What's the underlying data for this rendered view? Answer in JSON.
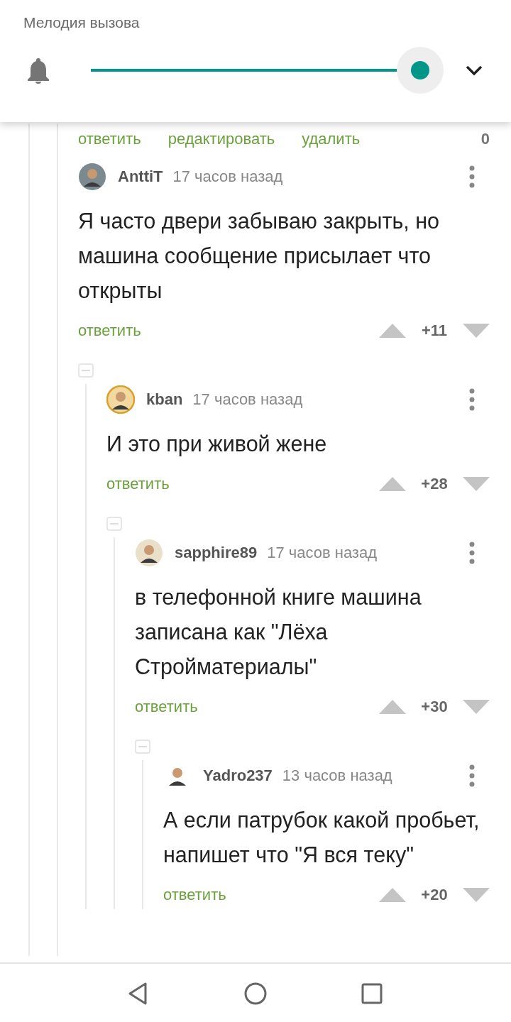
{
  "volume_panel": {
    "title": "Мелодия вызова",
    "slider": {
      "level": 1
    }
  },
  "previous_comment_actions": {
    "links": [
      "ответить",
      "редактировать",
      "удалить"
    ],
    "score": "0"
  },
  "comments": [
    {
      "author": "AnttiT",
      "time": "17 часов назад",
      "text": "Я часто двери забываю закрыть, но машина сообщение присылает что открыты",
      "reply": "ответить",
      "score": "+11",
      "children": [
        {
          "author": "kban",
          "time": "17 часов назад",
          "text": "И это при живой жене",
          "reply": "ответить",
          "score": "+28",
          "children": [
            {
              "author": "sapphire89",
              "time": "17 часов назад",
              "text": "в телефонной книге машина записана как \"Лёха Стройматериалы\"",
              "reply": "ответить",
              "score": "+30",
              "children": [
                {
                  "author": "Yadro237",
                  "time": "13 часов назад",
                  "text": "А если патрубок какой пробьет, напишет что \"Я вся теку\"",
                  "reply": "ответить",
                  "score": "+20"
                }
              ]
            }
          ]
        }
      ]
    }
  ]
}
